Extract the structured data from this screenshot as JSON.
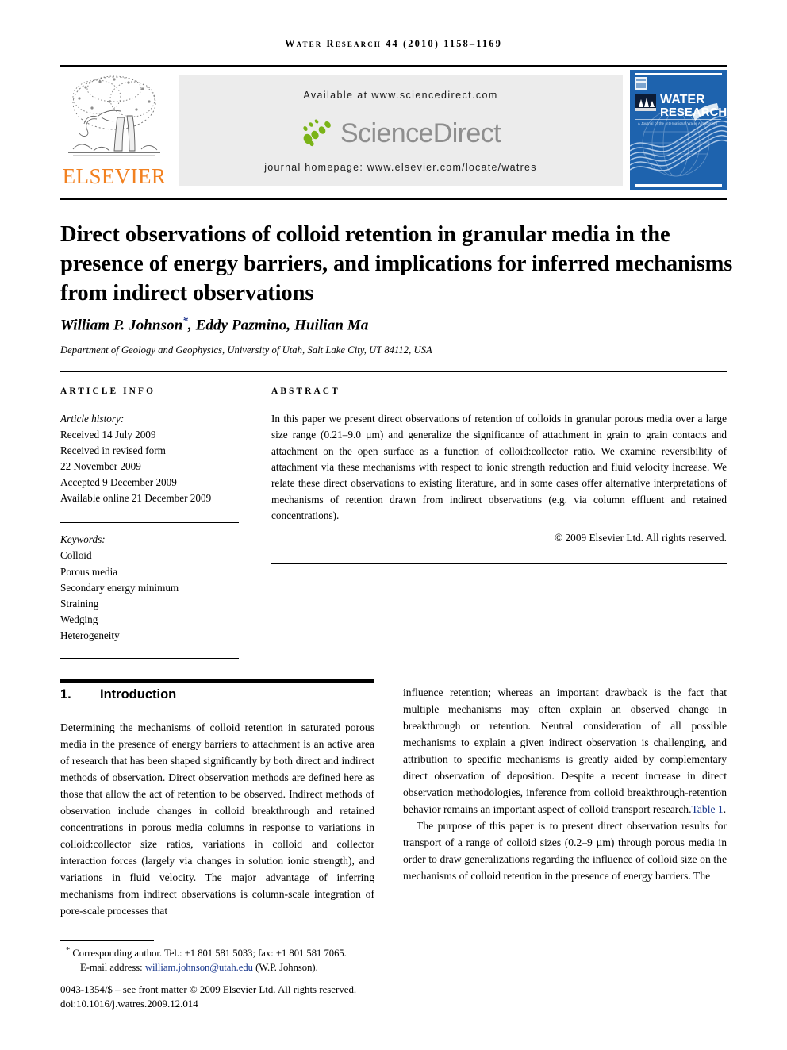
{
  "running_head": "Water Research 44 (2010) 1158–1169",
  "masthead": {
    "publisher_name": "ELSEVIER",
    "publisher_logo_icon": "elsevier-tree-icon",
    "available_at": "Available at www.sciencedirect.com",
    "sciencedirect_word": "ScienceDirect",
    "sciencedirect_leaves_icon": "sciencedirect-leaves-icon",
    "journal_homepage": "journal homepage: www.elsevier.com/locate/watres",
    "cover": {
      "line1": "WATER",
      "line2": "RESEARCH",
      "society_line": "A Journal of the International Water Association",
      "society_badge": "IWA",
      "color": "#1e63ae"
    }
  },
  "article": {
    "title": "Direct observations of colloid retention in granular media in the presence of energy barriers, and implications for inferred mechanisms from indirect observations",
    "authors": "William P. Johnson",
    "authors_rest": ", Eddy Pazmino, Huilian Ma",
    "corresponding_mark": "*",
    "affiliation": "Department of Geology and Geophysics, University of Utah, Salt Lake City, UT 84112, USA"
  },
  "article_info": {
    "heading": "Article info",
    "history_label": "Article history:",
    "history": [
      "Received 14 July 2009",
      "Received in revised form",
      "22 November 2009",
      "Accepted 9 December 2009",
      "Available online 21 December 2009"
    ],
    "keywords_label": "Keywords:",
    "keywords": [
      "Colloid",
      "Porous media",
      "Secondary energy minimum",
      "Straining",
      "Wedging",
      "Heterogeneity"
    ]
  },
  "abstract": {
    "heading": "Abstract",
    "text": "In this paper we present direct observations of retention of colloids in granular porous media over a large size range (0.21–9.0 µm) and generalize the significance of attachment in grain to grain contacts and attachment on the open surface as a function of colloid:collector ratio. We examine reversibility of attachment via these mechanisms with respect to ionic strength reduction and fluid velocity increase. We relate these direct observations to existing literature, and in some cases offer alternative interpretations of mechanisms of retention drawn from indirect observations (e.g. via column effluent and retained concentrations).",
    "copyright": "© 2009 Elsevier Ltd. All rights reserved."
  },
  "section": {
    "number": "1.",
    "title": "Introduction",
    "left_paragraph": "Determining the mechanisms of colloid retention in saturated porous media in the presence of energy barriers to attachment is an active area of research that has been shaped significantly by both direct and indirect methods of observation. Direct observation methods are defined here as those that allow the act of retention to be observed. Indirect methods of observation include changes in colloid breakthrough and retained concentrations in porous media columns in response to variations in colloid:collector size ratios, variations in colloid and collector interaction forces (largely via changes in solution ionic strength), and variations in fluid velocity. The major advantage of inferring mechanisms from indirect observations is column-scale integration of pore-scale processes that",
    "right_paragraph_1a": "influence retention; whereas an important drawback is the fact that multiple mechanisms may often explain an observed change in breakthrough or retention. Neutral consideration of all possible mechanisms to explain a given indirect observation is challenging, and attribution to specific mechanisms is greatly aided by complementary direct observation of deposition. Despite a recent increase in direct observation methodologies, inference from colloid breakthrough-retention behavior remains an important aspect of colloid transport research.",
    "right_link": "Table 1",
    "right_paragraph_1b": ".",
    "right_paragraph_2": "The purpose of this paper is to present direct observation results for transport of a range of colloid sizes (0.2–9 µm) through porous media in order to draw generalizations regarding the influence of colloid size on the mechanisms of colloid retention in the presence of energy barriers. The"
  },
  "footer": {
    "corresponding_mark": "*",
    "corresponding": "Corresponding author. Tel.: +1 801 581 5033; fax: +1 801 581 7065.",
    "email_label": "E-mail address:",
    "email": "william.johnson@utah.edu",
    "email_owner": "(W.P. Johnson).",
    "front_matter": "0043-1354/$ – see front matter © 2009 Elsevier Ltd. All rights reserved.",
    "doi": "doi:10.1016/j.watres.2009.12.014"
  },
  "colors": {
    "link": "#17368c",
    "elsevier_orange": "#f28120",
    "sciencedirect_gray": "#8e8e8e",
    "sciencedirect_green": "#7ab317",
    "cover_blue": "#1e63ae",
    "panel_gray": "#ececec"
  }
}
